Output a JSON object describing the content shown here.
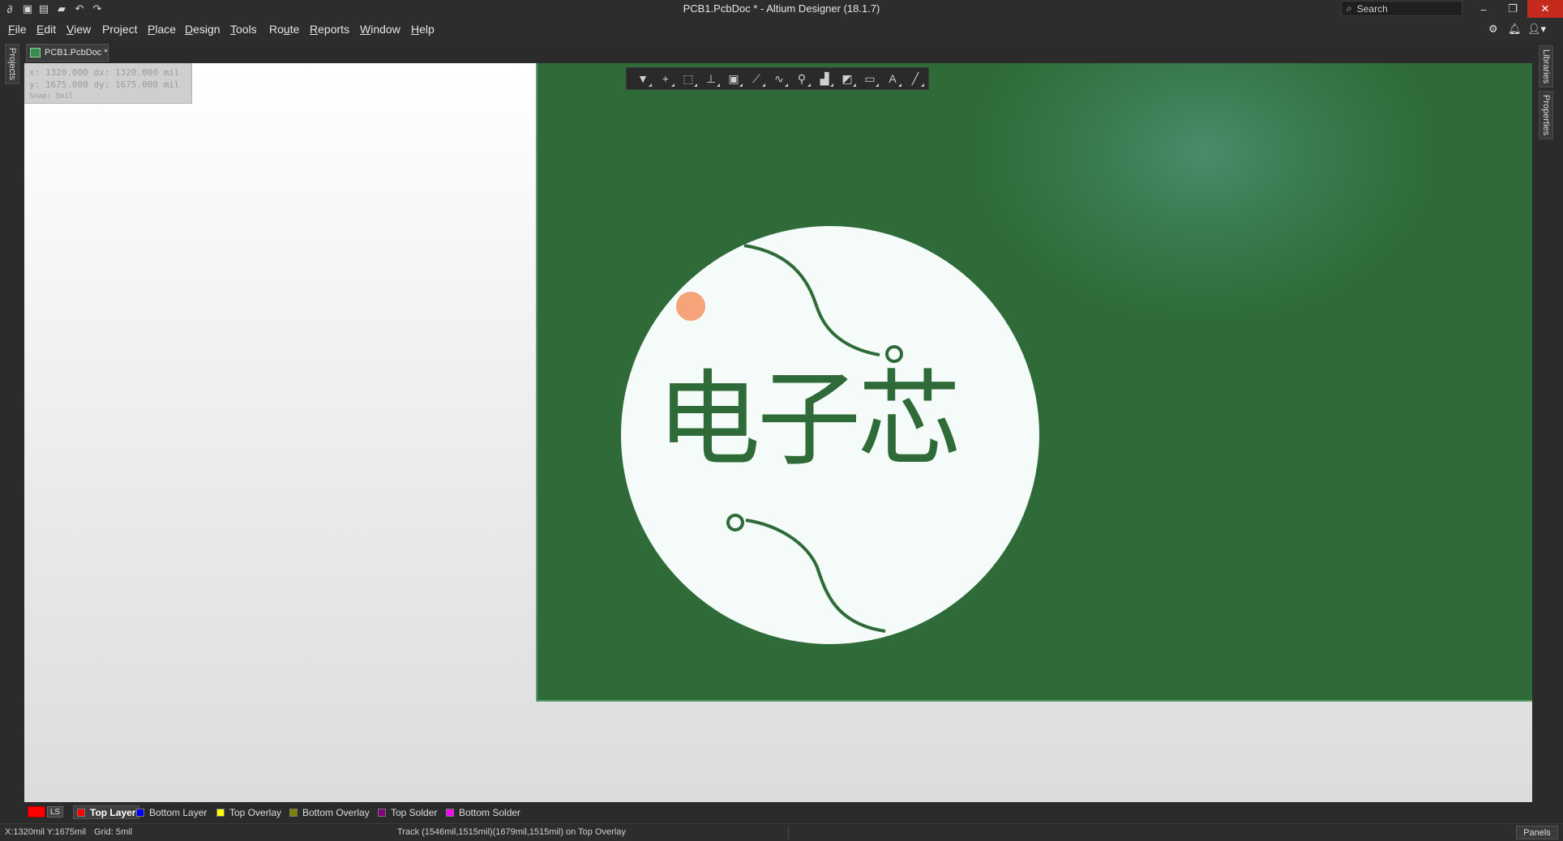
{
  "titlebar": {
    "title": "PCB1.PcbDoc * - Altium Designer (18.1.7)",
    "search_placeholder": "Search",
    "minimize": "–",
    "restore": "❐",
    "close": "✕"
  },
  "menu": [
    "File",
    "Edit",
    "View",
    "Project",
    "Place",
    "Design",
    "Tools",
    "Route",
    "Reports",
    "Window",
    "Help"
  ],
  "menu_underline": [
    "F",
    "E",
    "V",
    "j",
    "P",
    "D",
    "T",
    "u",
    "R",
    "W",
    "H"
  ],
  "side_panels": {
    "left": "Projects",
    "right_1": "Libraries",
    "right_2": "Properties"
  },
  "document_tab": {
    "label": "PCB1.PcbDoc *"
  },
  "hud": {
    "line1": "x: 1320.000  dx: 1320.000 mil",
    "line2": "y: 1675.000  dy: 1675.000 mil",
    "line3": "Snap: 5mil"
  },
  "logo": {
    "text": "电子芯"
  },
  "colors": {
    "board": "#2e6b39",
    "board_glow": "#4a8c6a",
    "logo_fill": "#2e6b39",
    "circle": "#f5fbf8",
    "cursor_dot": "#f59a6b"
  },
  "layers": {
    "ls_label": "LS",
    "items": [
      {
        "label": "Top Layer",
        "color": "#ff0000",
        "active": true
      },
      {
        "label": "Bottom Layer",
        "color": "#0000ff",
        "active": false
      },
      {
        "label": "Top Overlay",
        "color": "#ffff00",
        "active": false
      },
      {
        "label": "Bottom Overlay",
        "color": "#808000",
        "active": false
      },
      {
        "label": "Top Solder",
        "color": "#800080",
        "active": false
      },
      {
        "label": "Bottom Solder",
        "color": "#ff00ff",
        "active": false
      }
    ]
  },
  "status": {
    "coords": "X:1320mil Y:1675mil",
    "grid": "Grid: 5mil",
    "message": "Track (1546mil,1515mil)(1679mil,1515mil) on Top Overlay",
    "panels": "Panels"
  }
}
